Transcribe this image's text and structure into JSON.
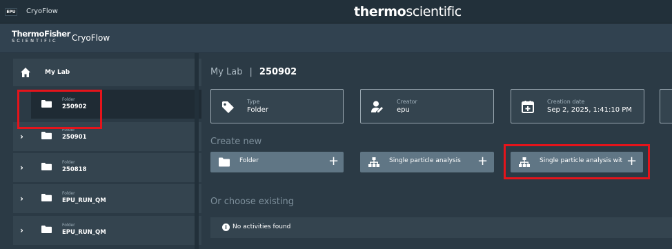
{
  "titlebar": {
    "badge": "EPU",
    "app": "CryoFlow",
    "brand_bold": "thermo",
    "brand_light": "scientific"
  },
  "header": {
    "logo_line1": "ThermoFisher",
    "logo_line2": "SCIENTIFIC",
    "app": "CryoFlow"
  },
  "sidebar": {
    "home_label": "My Lab",
    "items": [
      {
        "small": "Folder",
        "name": "250902",
        "selected": true,
        "expandable": false
      },
      {
        "small": "Folder",
        "name": "250901",
        "selected": false,
        "expandable": true
      },
      {
        "small": "Folder",
        "name": "250818",
        "selected": false,
        "expandable": true
      },
      {
        "small": "Folder",
        "name": "EPU_RUN_QM",
        "selected": false,
        "expandable": true
      },
      {
        "small": "Folder",
        "name": "EPU_RUN_QM",
        "selected": false,
        "expandable": true
      }
    ],
    "chevron": "›"
  },
  "breadcrumb": {
    "root": "My Lab",
    "separator": "|",
    "current": "250902"
  },
  "info_cards": [
    {
      "label": "Type",
      "value": "Folder",
      "icon": "tag-icon"
    },
    {
      "label": "Creator",
      "value": "epu",
      "icon": "user-edit-icon"
    },
    {
      "label": "Creation date",
      "value": "Sep 2, 2025, 1:41:10 PM",
      "icon": "calendar-plus-icon"
    }
  ],
  "create_new": {
    "title": "Create new",
    "buttons": [
      {
        "label": "Folder",
        "icon": "folder-icon"
      },
      {
        "label": "Single particle analysis",
        "icon": "hierarchy-icon"
      },
      {
        "label": "Single particle analysis witl",
        "icon": "hierarchy-icon"
      }
    ],
    "plus": "+"
  },
  "choose_existing": {
    "title": "Or choose existing",
    "empty_message": "No activities found",
    "info_glyph": "i"
  },
  "colors": {
    "background": "#2b3a45",
    "panel": "#34444f",
    "selected": "#1f2b34",
    "button": "#607685",
    "annotation": "#e5141b"
  }
}
